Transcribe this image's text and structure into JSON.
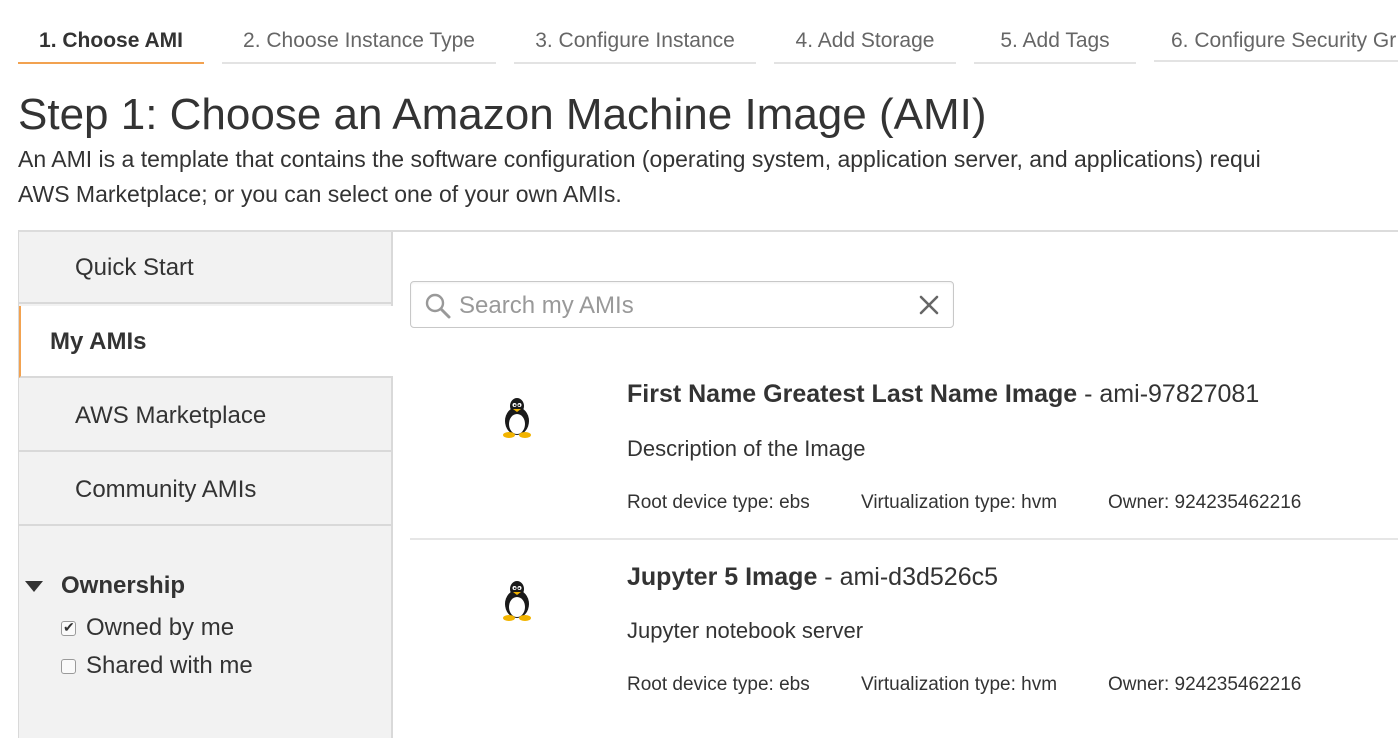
{
  "wizard": {
    "tabs": [
      {
        "label": "1. Choose AMI",
        "active": true
      },
      {
        "label": "2. Choose Instance Type"
      },
      {
        "label": "3. Configure Instance"
      },
      {
        "label": "4. Add Storage"
      },
      {
        "label": "5. Add Tags"
      },
      {
        "label": "6. Configure Security Gr"
      }
    ]
  },
  "page": {
    "title": "Step 1: Choose an Amazon Machine Image (AMI)",
    "intro_line1": "An AMI is a template that contains the software configuration (operating system, application server, and applications) requi",
    "intro_line2": "AWS Marketplace; or you can select one of your own AMIs."
  },
  "sidebar": {
    "items": [
      {
        "label": "Quick Start"
      },
      {
        "label": "My AMIs",
        "active": true
      },
      {
        "label": "AWS Marketplace"
      },
      {
        "label": "Community AMIs"
      }
    ],
    "filter": {
      "title": "Ownership",
      "options": [
        {
          "label": "Owned by me",
          "checked": true
        },
        {
          "label": "Shared with me",
          "checked": false
        }
      ]
    }
  },
  "search": {
    "placeholder": "Search my AMIs",
    "value": ""
  },
  "amis": [
    {
      "name": "First Name Greatest Last Name Image",
      "id": " - ami-97827081",
      "description": "Description of the Image",
      "root_device": "Root device type: ebs",
      "virtualization": "Virtualization type: hvm",
      "owner": "Owner: 924235462216",
      "icon": "linux-tux-icon"
    },
    {
      "name": "Jupyter 5 Image",
      "id": " - ami-d3d526c5",
      "description": "Jupyter notebook server",
      "root_device": "Root device type: ebs",
      "virtualization": "Virtualization type: hvm",
      "owner": "Owner: 924235462216",
      "icon": "linux-tux-icon"
    }
  ],
  "colors": {
    "accent": "#f2a250",
    "sidebar_bg": "#f2f2f2",
    "text": "#333333"
  }
}
